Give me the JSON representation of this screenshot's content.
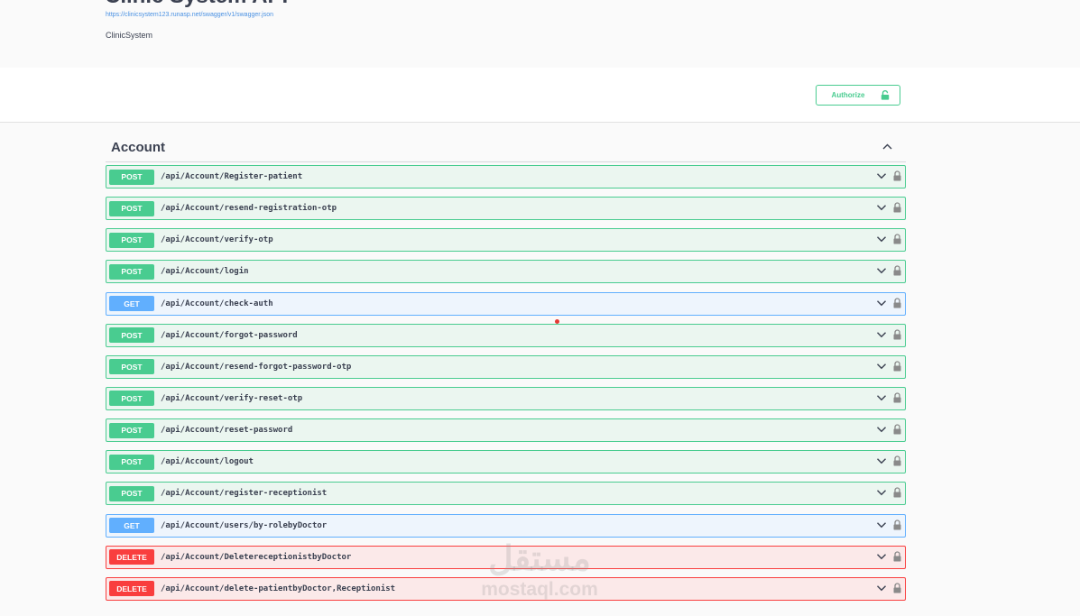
{
  "info": {
    "title": "Clinic System API",
    "url": "https://clinicsystem123.runasp.net/swagger/v1/swagger.json",
    "description": "ClinicSystem"
  },
  "auth": {
    "label": "Authorize"
  },
  "tag": {
    "name": "Account"
  },
  "operations": [
    {
      "method": "POST",
      "path": "/api/Account/Register-patient"
    },
    {
      "method": "POST",
      "path": "/api/Account/resend-registration-otp"
    },
    {
      "method": "POST",
      "path": "/api/Account/verify-otp"
    },
    {
      "method": "POST",
      "path": "/api/Account/login"
    },
    {
      "method": "GET",
      "path": "/api/Account/check-auth"
    },
    {
      "method": "POST",
      "path": "/api/Account/forgot-password"
    },
    {
      "method": "POST",
      "path": "/api/Account/resend-forgot-password-otp"
    },
    {
      "method": "POST",
      "path": "/api/Account/verify-reset-otp"
    },
    {
      "method": "POST",
      "path": "/api/Account/reset-password"
    },
    {
      "method": "POST",
      "path": "/api/Account/logout"
    },
    {
      "method": "POST",
      "path": "/api/Account/register-receptionist"
    },
    {
      "method": "GET",
      "path": "/api/Account/users/by-rolebyDoctor"
    },
    {
      "method": "DELETE",
      "path": "/api/Account/DeletereceptionistbyDoctor"
    },
    {
      "method": "DELETE",
      "path": "/api/Account/delete-patientbyDoctor,Receptionist"
    }
  ],
  "watermark": {
    "arabic": "مستقل",
    "latin": "mostaql.com"
  },
  "colors": {
    "post": "#49cc90",
    "get": "#61affe",
    "delete": "#f93e3e",
    "text": "#3b4151",
    "link": "#4990e2"
  },
  "icons": {
    "authorize": "lock-open-icon",
    "tag_toggle": "chevron-up-icon",
    "op_expand": "chevron-down-icon",
    "op_lock": "lock-icon"
  }
}
